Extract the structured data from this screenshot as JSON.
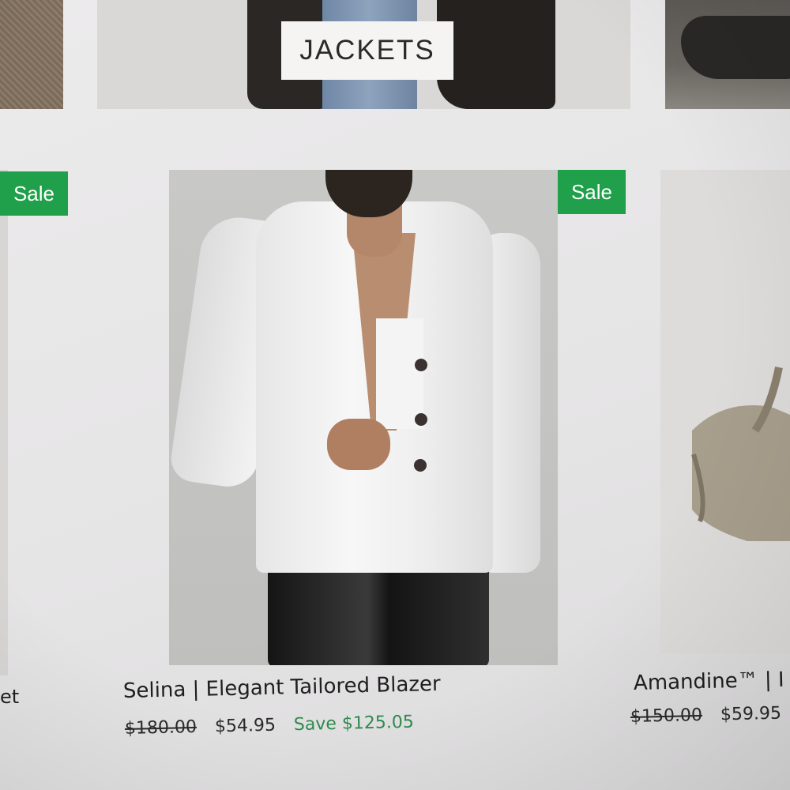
{
  "categories": {
    "jackets_label": "JACKETS"
  },
  "products": [
    {
      "name": "et",
      "sale_badge": "Sale"
    },
    {
      "name": "Selina | Elegant Tailored Blazer",
      "sale_badge": "Sale",
      "price_original": "$180.00",
      "price_sale": "$54.95",
      "savings": "Save $125.05"
    },
    {
      "name": "Amandine™ | I",
      "price_original": "$150.00",
      "price_sale": "$59.95"
    }
  ],
  "colors": {
    "sale_badge": "#20a04a",
    "savings_text": "#2f8a4e"
  }
}
